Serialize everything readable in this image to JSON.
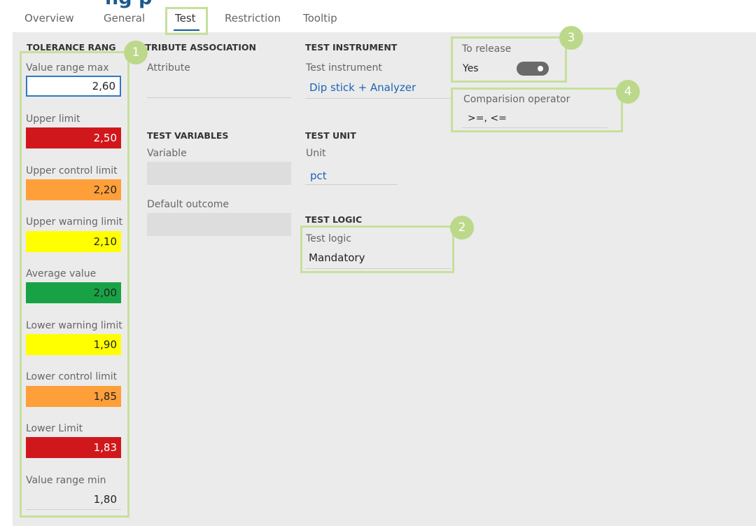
{
  "tabs": [
    {
      "label": "Overview"
    },
    {
      "label": "General"
    },
    {
      "label": "Test"
    },
    {
      "label": "Restriction"
    },
    {
      "label": "Tooltip"
    }
  ],
  "active_tab": "Test",
  "tolerance": {
    "header": "TOLERANCE RANG",
    "items": [
      {
        "label": "Value range max",
        "value": "2,60",
        "color": "#ffffff"
      },
      {
        "label": "Upper limit",
        "value": "2,50",
        "color": "#d0181c"
      },
      {
        "label": "Upper control limit",
        "value": "2,20",
        "color": "#ff9f3a"
      },
      {
        "label": "Upper warning limit",
        "value": "2,10",
        "color": "#ffff00"
      },
      {
        "label": "Average value",
        "value": "2,00",
        "color": "#17a345"
      },
      {
        "label": "Lower warning limit",
        "value": "1,90",
        "color": "#ffff00"
      },
      {
        "label": "Lower control limit",
        "value": "1,85",
        "color": "#ff9f3a"
      },
      {
        "label": "Lower Limit",
        "value": "1,83",
        "color": "#d0181c"
      },
      {
        "label": "Value range min",
        "value": "1,80",
        "color": "#ebebeb"
      }
    ]
  },
  "attribute_association": {
    "header": "ATTRIBUTE ASSOCIATION",
    "attribute_label": "Attribute",
    "attribute_value": ""
  },
  "test_variables": {
    "header": "TEST VARIABLES",
    "variable_label": "Variable",
    "default_outcome_label": "Default outcome"
  },
  "test_instrument": {
    "header": "TEST INSTRUMENT",
    "label": "Test instrument",
    "value": "Dip stick + Analyzer"
  },
  "test_unit": {
    "header": "TEST UNIT",
    "label": "Unit",
    "value": "pct"
  },
  "test_logic": {
    "header": "TEST LOGIC",
    "label": "Test logic",
    "value": "Mandatory"
  },
  "to_release": {
    "label": "To release",
    "value": "Yes",
    "toggle_on": true
  },
  "comparison": {
    "label": "Comparision operator",
    "value": ">=, <="
  },
  "callouts": [
    "1",
    "2",
    "3",
    "4"
  ],
  "colors": {
    "accent": "#0f5c97",
    "callout": "#bcd88a",
    "frame": "#c6e09b",
    "link_blue": "#1f63b5"
  }
}
